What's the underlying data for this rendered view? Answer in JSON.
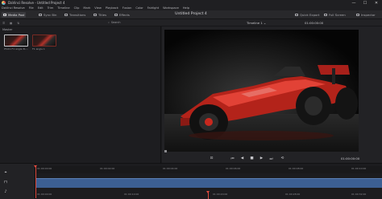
{
  "window": {
    "title": "DaVinci Resolve - Untitled Project 4",
    "controls": [
      "—",
      "☐",
      "✕"
    ]
  },
  "menu": [
    "DaVinci Resolve",
    "File",
    "Edit",
    "Trim",
    "Timeline",
    "Clip",
    "Mark",
    "View",
    "Playback",
    "Fusion",
    "Color",
    "Fairlight",
    "Workspace",
    "Help"
  ],
  "toolbar": {
    "media_pool": "Media Pool",
    "sync_bin": "Sync Bin",
    "transitions": "Transitions",
    "titles": "Titles",
    "effects": "Effects",
    "project_title": "Untitled Project 4",
    "quick_export": "Quick Export",
    "full_screen": "Full Screen",
    "inspector": "Inspector"
  },
  "subbar": {
    "search_label": "Search",
    "timeline_name": "Timeline 1 ⌄",
    "timecode": "01:00:00:00"
  },
  "media_pool": {
    "master_label": "Master",
    "clips": [
      {
        "name": "Photo F1 angle 3L..."
      },
      {
        "name": "F1 angle 1"
      }
    ]
  },
  "viewer": {
    "timecode": "01:00:00:00",
    "transport": {
      "first": "⏮",
      "prev": "◀",
      "stop": "■",
      "play": "▶",
      "next": "⏭",
      "loop": "⟲"
    }
  },
  "timeline": {
    "ruler": [
      "01:00:00:00",
      "01:00:02:00",
      "01:00:04:00",
      "01:00:06:00",
      "01:00:08:00",
      "01:00:10:00"
    ],
    "ruler2": [
      "01:00:00:00",
      "01:00:10:00",
      "01:00:20:00",
      "01:00:28:00",
      "01:00:32:00"
    ]
  },
  "colors": {
    "track": "#3c5f93",
    "playhead": "#e04a3f",
    "car_red": "#c8281e"
  }
}
